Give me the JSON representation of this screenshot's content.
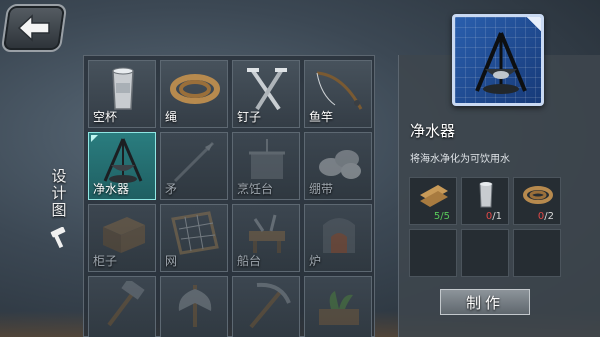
{
  "side_tab": {
    "label": "设计图",
    "icon": "hammer-icon"
  },
  "recipes": [
    {
      "name": "空杯",
      "icon": "cup-icon",
      "locked": false,
      "selected": false
    },
    {
      "name": "绳",
      "icon": "rope-icon",
      "locked": false,
      "selected": false
    },
    {
      "name": "钉子",
      "icon": "nails-icon",
      "locked": false,
      "selected": false
    },
    {
      "name": "鱼竿",
      "icon": "fishing-rod-icon",
      "locked": false,
      "selected": false
    },
    {
      "name": "净水器",
      "icon": "water-purifier-icon",
      "locked": false,
      "selected": true
    },
    {
      "name": "矛",
      "icon": "spear-icon",
      "locked": true,
      "selected": false
    },
    {
      "name": "烹饪台",
      "icon": "cooking-station-icon",
      "locked": true,
      "selected": false
    },
    {
      "name": "绷带",
      "icon": "bandage-icon",
      "locked": true,
      "selected": false
    },
    {
      "name": "柜子",
      "icon": "cabinet-icon",
      "locked": true,
      "selected": false
    },
    {
      "name": "网",
      "icon": "net-icon",
      "locked": true,
      "selected": false
    },
    {
      "name": "船台",
      "icon": "boat-station-icon",
      "locked": true,
      "selected": false
    },
    {
      "name": "炉",
      "icon": "furnace-icon",
      "locked": true,
      "selected": false
    },
    {
      "name": "",
      "icon": "hammer-tool-icon",
      "locked": true,
      "selected": false
    },
    {
      "name": "",
      "icon": "axe-icon",
      "locked": true,
      "selected": false
    },
    {
      "name": "",
      "icon": "pickaxe-icon",
      "locked": true,
      "selected": false
    },
    {
      "name": "",
      "icon": "planter-icon",
      "locked": true,
      "selected": false
    }
  ],
  "detail": {
    "title": "净水器",
    "description": "将海水净化为可饮用水",
    "blueprint_icon": "water-purifier-blueprint-icon",
    "requirements": [
      {
        "icon": "planks-icon",
        "count": "5/5",
        "have": "5",
        "need": "/5",
        "color": "#58c85a"
      },
      {
        "icon": "cup-icon",
        "count": "0/1",
        "have": "0",
        "need": "/1",
        "color": "#e04848"
      },
      {
        "icon": "rope-icon",
        "count": "0/2",
        "have": "0",
        "need": "/2",
        "color": "#e04848"
      },
      {
        "icon": "",
        "count": ""
      },
      {
        "icon": "",
        "count": ""
      },
      {
        "icon": "",
        "count": ""
      }
    ],
    "craft_label": "制作"
  },
  "colors": {
    "selected": "#2a7d7f",
    "ok": "#58c85a",
    "missing": "#e04848"
  }
}
